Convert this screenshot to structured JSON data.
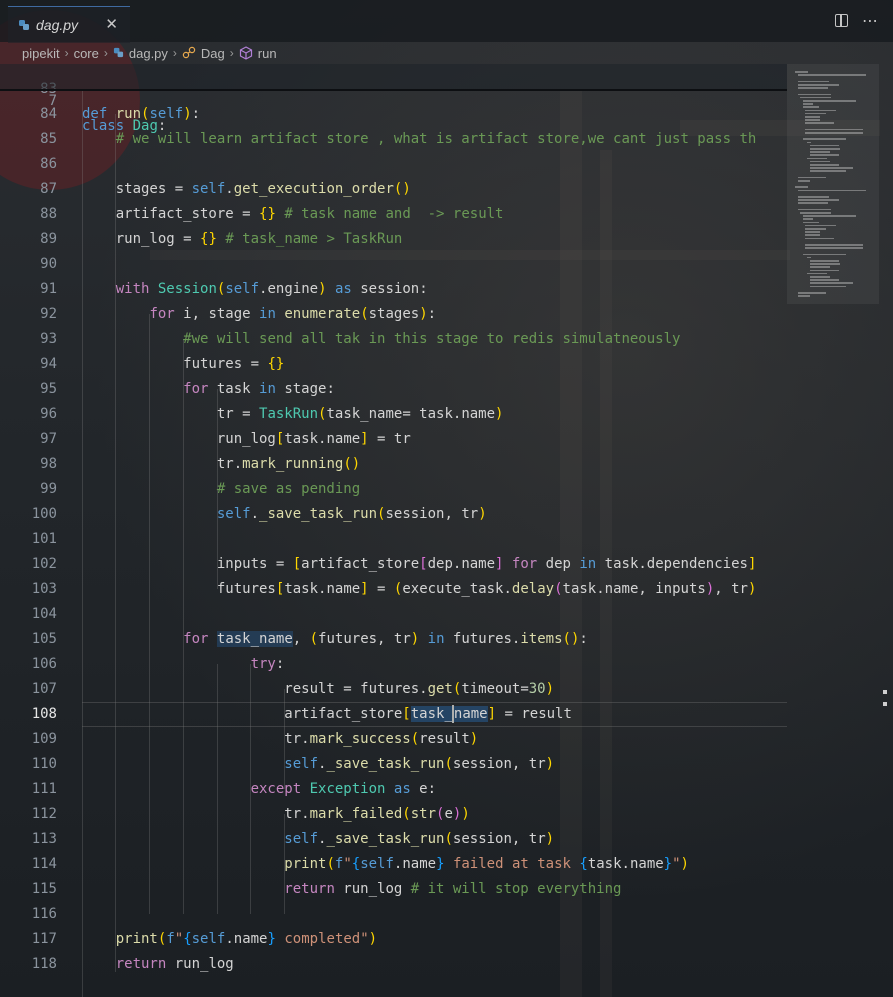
{
  "tab": {
    "filename": "dag.py",
    "close_glyph": "✕",
    "icon": "python-file-icon"
  },
  "breadcrumb": [
    "pipekit",
    "core",
    "dag.py",
    "Dag",
    "run"
  ],
  "sticky": {
    "line_number": "7",
    "code": "class Dag:"
  },
  "active_line": "108",
  "colors": {
    "keyword": "#569cd6",
    "control": "#c586c0",
    "function": "#dcdcaa",
    "class": "#4ec9b0",
    "string": "#ce9178",
    "comment": "#6a9955",
    "number": "#b5cea8"
  },
  "lines": [
    {
      "n": "83",
      "code": ""
    },
    {
      "n": "84",
      "code": "    def run(self):"
    },
    {
      "n": "85",
      "code": "        # we will learn artifact store , what is artifact store,we cant just pass th"
    },
    {
      "n": "86",
      "code": ""
    },
    {
      "n": "87",
      "code": "        stages = self.get_execution_order()"
    },
    {
      "n": "88",
      "code": "        artifact_store = {} # task name and  -> result"
    },
    {
      "n": "89",
      "code": "        run_log = {} # task_name > TaskRun"
    },
    {
      "n": "90",
      "code": ""
    },
    {
      "n": "91",
      "code": "        with Session(self.engine) as session:"
    },
    {
      "n": "92",
      "code": "            for i, stage in enumerate(stages):"
    },
    {
      "n": "93",
      "code": "                #we will send all tak in this stage to redis simulatneously"
    },
    {
      "n": "94",
      "code": "                futures = {}"
    },
    {
      "n": "95",
      "code": "                for task in stage:"
    },
    {
      "n": "96",
      "code": "                    tr = TaskRun(task_name= task.name)"
    },
    {
      "n": "97",
      "code": "                    run_log[task.name] = tr"
    },
    {
      "n": "98",
      "code": "                    tr.mark_running()"
    },
    {
      "n": "99",
      "code": "                    # save as pending"
    },
    {
      "n": "100",
      "code": "                    self._save_task_run(session, tr)"
    },
    {
      "n": "101",
      "code": ""
    },
    {
      "n": "102",
      "code": "                    inputs = [artifact_store[dep.name] for dep in task.dependencies]"
    },
    {
      "n": "103",
      "code": "                    futures[task.name] = (execute_task.delay(task.name, inputs), tr)"
    },
    {
      "n": "104",
      "code": ""
    },
    {
      "n": "105",
      "code": "                for task_name, (futures, tr) in futures.items():"
    },
    {
      "n": "106",
      "code": "                        try:"
    },
    {
      "n": "107",
      "code": "                            result = futures.get(timeout=30)"
    },
    {
      "n": "108",
      "code": "                            artifact_store[task_name] = result"
    },
    {
      "n": "109",
      "code": "                            tr.mark_success(result)"
    },
    {
      "n": "110",
      "code": "                            self._save_task_run(session, tr)"
    },
    {
      "n": "111",
      "code": "                        except Exception as e:"
    },
    {
      "n": "112",
      "code": "                            tr.mark_failed(str(e))"
    },
    {
      "n": "113",
      "code": "                            self._save_task_run(session, tr)"
    },
    {
      "n": "114",
      "code": "                            print(f\"{self.name} failed at task {task.name}\")"
    },
    {
      "n": "115",
      "code": "                            return run_log # it will stop everything"
    },
    {
      "n": "116",
      "code": ""
    },
    {
      "n": "117",
      "code": "        print(f\"{self.name} completed\")"
    },
    {
      "n": "118",
      "code": "        return run_log"
    }
  ]
}
